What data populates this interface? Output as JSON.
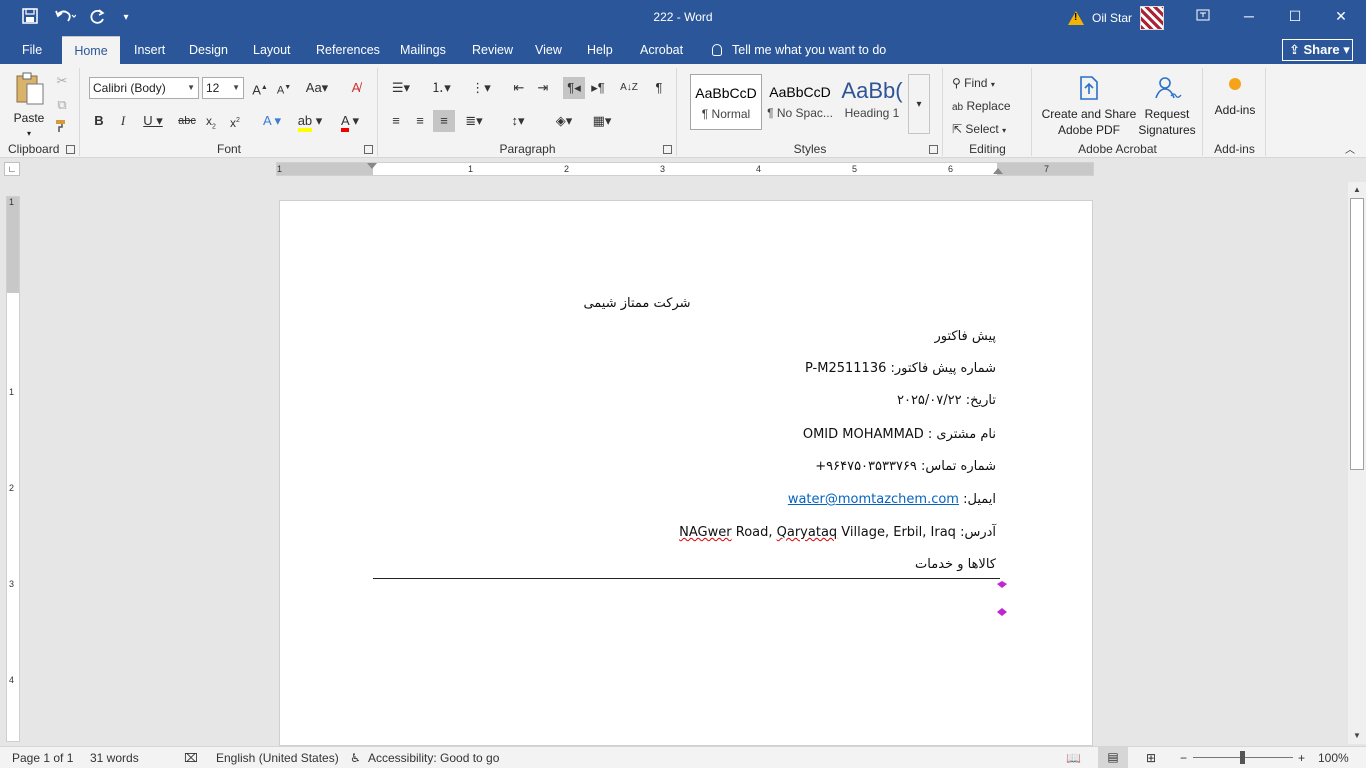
{
  "titlebar": {
    "title": "222  -  Word",
    "user": "Oil Star",
    "qat": {
      "save_icon": "save-icon",
      "undo_icon": "undo-icon",
      "redo_icon": "redo-icon"
    }
  },
  "tabs": [
    "File",
    "Home",
    "Insert",
    "Design",
    "Layout",
    "References",
    "Mailings",
    "Review",
    "View",
    "Help",
    "Acrobat"
  ],
  "tellme": "Tell me what you want to do",
  "share": "Share",
  "ribbon": {
    "clipboard": {
      "label": "Clipboard",
      "paste": "Paste"
    },
    "font": {
      "label": "Font",
      "family": "Calibri (Body)",
      "size": "12"
    },
    "paragraph": {
      "label": "Paragraph"
    },
    "styles": {
      "label": "Styles",
      "items": [
        {
          "sample": "AaBbCcD",
          "name": "¶ Normal"
        },
        {
          "sample": "AaBbCcD",
          "name": "¶ No Spac..."
        },
        {
          "sample": "AaBb(",
          "name": "Heading 1"
        }
      ]
    },
    "editing": {
      "label": "Editing",
      "find": "Find",
      "replace": "Replace",
      "select": "Select"
    },
    "acrobat": {
      "label": "Adobe Acrobat",
      "create_l1": "Create and Share",
      "create_l2": "Adobe PDF",
      "request_l1": "Request",
      "request_l2": "Signatures"
    },
    "addins": {
      "label": "Add-ins",
      "button": "Add-ins"
    }
  },
  "ruler": {
    "h_numbers": [
      "1",
      "1",
      "2",
      "3",
      "4",
      "5",
      "6",
      "7"
    ],
    "v_numbers": [
      "1",
      "1",
      "2",
      "3",
      "4"
    ]
  },
  "document": {
    "company": "شرکت ممتاز شیمی",
    "heading": "پیش فاکتور",
    "invoice_label": "شماره پیش فاکتور: ",
    "invoice_no": "P-M2511136",
    "date_label": "تاریخ: ",
    "date_value": "۲۰۲۵/۰۷/۲۲",
    "customer_label": "نام مشتری : ",
    "customer_value": "OMID MOHAMMAD",
    "phone_label": "شماره تماس: ",
    "phone_value": "+۹۶۴۷۵۰۳۵۳۳۷۶۹",
    "email_label": "ایمیل: ",
    "email_value": "water@momtazchem.com",
    "address_label": "آدرس: ",
    "address_p1": "NAGwer",
    "address_p2": " Road, ",
    "address_p3": "Qaryataq",
    "address_p4": " Village, Erbil, Iraq",
    "goods": "کالاها و خدمات"
  },
  "status": {
    "page": "Page 1 of 1",
    "words": "31 words",
    "language": "English (United States)",
    "accessibility": "Accessibility: Good to go",
    "zoom": "100%",
    "zoom_level_percent": 100
  },
  "colors": {
    "accent": "#2b579a",
    "link": "#0563c1",
    "para_mark": "#c026d3"
  }
}
